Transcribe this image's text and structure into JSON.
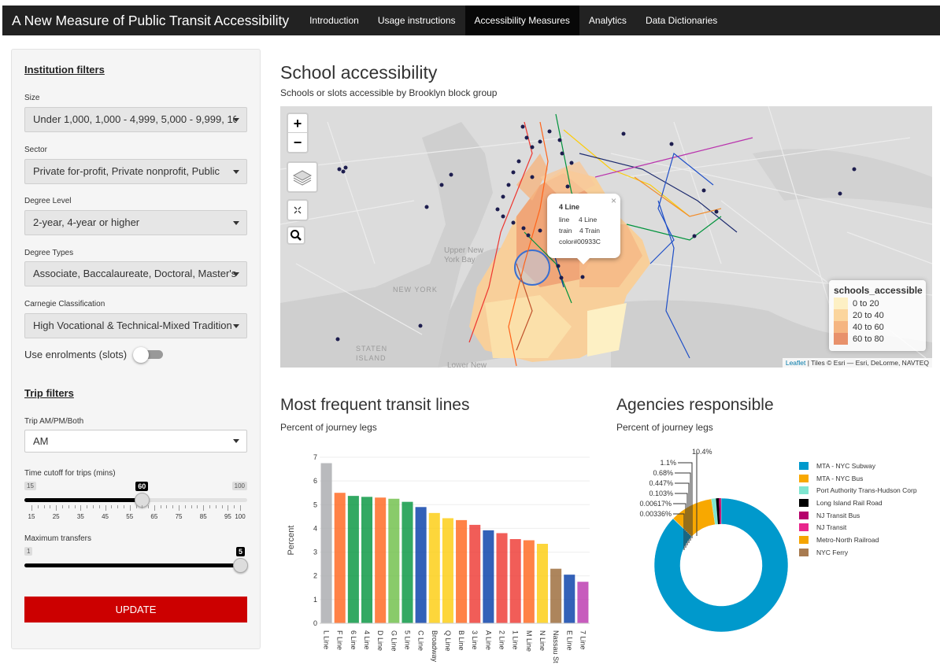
{
  "navbar": {
    "brand": "A New Measure of Public Transit Accessibility",
    "items": [
      {
        "label": "Introduction",
        "active": false
      },
      {
        "label": "Usage instructions",
        "active": false
      },
      {
        "label": "Accessibility Measures",
        "active": true
      },
      {
        "label": "Analytics",
        "active": false
      },
      {
        "label": "Data Dictionaries",
        "active": false
      }
    ]
  },
  "sidebar": {
    "institution_title": "Institution filters",
    "size": {
      "label": "Size",
      "value": "Under 1,000, 1,000 - 4,999, 5,000 - 9,999, 10"
    },
    "sector": {
      "label": "Sector",
      "value": "Private for-profit, Private nonprofit, Public"
    },
    "degree_level": {
      "label": "Degree Level",
      "value": "2-year, 4-year or higher"
    },
    "degree_types": {
      "label": "Degree Types",
      "value": "Associate, Baccalaureate, Doctoral, Master's"
    },
    "carnegie": {
      "label": "Carnegie Classification",
      "value": "High Vocational & Technical-Mixed Tradition"
    },
    "enrolments_toggle": {
      "label": "Use enrolments (slots)",
      "on": false
    },
    "trip_title": "Trip filters",
    "trip_time": {
      "label": "Trip AM/PM/Both",
      "value": "AM"
    },
    "cutoff": {
      "label": "Time cutoff for trips (mins)",
      "min": "15",
      "max": "100",
      "value": "60",
      "ticks": [
        "15",
        "25",
        "35",
        "45",
        "55",
        "65",
        "75",
        "85",
        "95",
        "100"
      ]
    },
    "transfers": {
      "label": "Maximum transfers",
      "min": "1",
      "max": "5",
      "value": "5"
    },
    "update_label": "UPDATE"
  },
  "school": {
    "title": "School accessibility",
    "subtitle": "Schools or slots accessible by Brooklyn block group"
  },
  "map": {
    "zoom_in": "+",
    "zoom_out": "−",
    "place_labels": [
      "Upper New York Bay",
      "NEW YORK",
      "STATEN ISLAND",
      "Lower New"
    ],
    "popup": {
      "title": "4 Line",
      "rows": [
        [
          "line",
          "4 Line"
        ],
        [
          "train",
          "4 Train"
        ],
        [
          "color",
          "#00933C"
        ]
      ],
      "close": "×"
    },
    "legend": {
      "title": "schools_accessible",
      "items": [
        {
          "label": "0 to 20",
          "color": "#fdf0c4"
        },
        {
          "label": "20 to 40",
          "color": "#fbd59d"
        },
        {
          "label": "40 to 60",
          "color": "#f5b581"
        },
        {
          "label": "60 to 80",
          "color": "#e8916b"
        }
      ]
    },
    "attribution_link": "Leaflet",
    "attribution_text": " | Tiles © Esri — Esri, DeLorme, NAVTEQ"
  },
  "lines_chart": {
    "title": "Most frequent transit lines",
    "subtitle": "Percent of journey legs"
  },
  "agency_chart": {
    "title": "Agencies responsible",
    "subtitle": "Percent of journey legs"
  },
  "chart_data": [
    {
      "type": "bar",
      "ylabel": "Percent",
      "ylim": [
        0,
        7
      ],
      "yticks": [
        0,
        1,
        2,
        3,
        4,
        5,
        6,
        7
      ],
      "categories": [
        "L Line",
        "F Line",
        "6 Line",
        "4 Line",
        "D Line",
        "G Line",
        "5 Line",
        "C Line",
        "Broadway",
        "Q Line",
        "B Line",
        "3 Line",
        "A Line",
        "2 Line",
        "1 Line",
        "M Line",
        "N Line",
        "Nassau St",
        "E Line",
        "7 Line"
      ],
      "values": [
        6.75,
        5.5,
        5.37,
        5.33,
        5.3,
        5.25,
        5.12,
        4.9,
        4.65,
        4.43,
        4.35,
        4.15,
        3.92,
        3.8,
        3.55,
        3.5,
        3.35,
        2.3,
        2.05,
        1.75
      ],
      "colors": [
        "#a7a9ac",
        "#ff6319",
        "#00933c",
        "#00933c",
        "#ff6319",
        "#6cbe45",
        "#00933c",
        "#0039a6",
        "#fccc0a",
        "#fccc0a",
        "#ff6319",
        "#ee352e",
        "#0039a6",
        "#ee352e",
        "#ee352e",
        "#ff6319",
        "#fccc0a",
        "#996633",
        "#0039a6",
        "#b933ad"
      ]
    },
    {
      "type": "pie",
      "hole": true,
      "labels": [
        "MTA - NYC Subway",
        "MTA - NYC Bus",
        "Port Authority Trans-Hudson Corp",
        "Long Island Rail Road",
        "NJ Transit Bus",
        "NJ Transit",
        "Metro-North Railroad",
        "NYC Ferry"
      ],
      "values": [
        87.2,
        10.4,
        1.1,
        0.68,
        0.447,
        0.103,
        0.00617,
        0.00336
      ],
      "colors": [
        "#0099cc",
        "#f8a800",
        "#7fe5d0",
        "#000000",
        "#b5006b",
        "#e8268c",
        "#f5a400",
        "#a87b50"
      ],
      "slice_labels": [
        "87.2%",
        "10.4%",
        "1.1%",
        "0.68%",
        "0.447%",
        "0.103%",
        "0.00617%",
        "0.00336%"
      ]
    }
  ]
}
